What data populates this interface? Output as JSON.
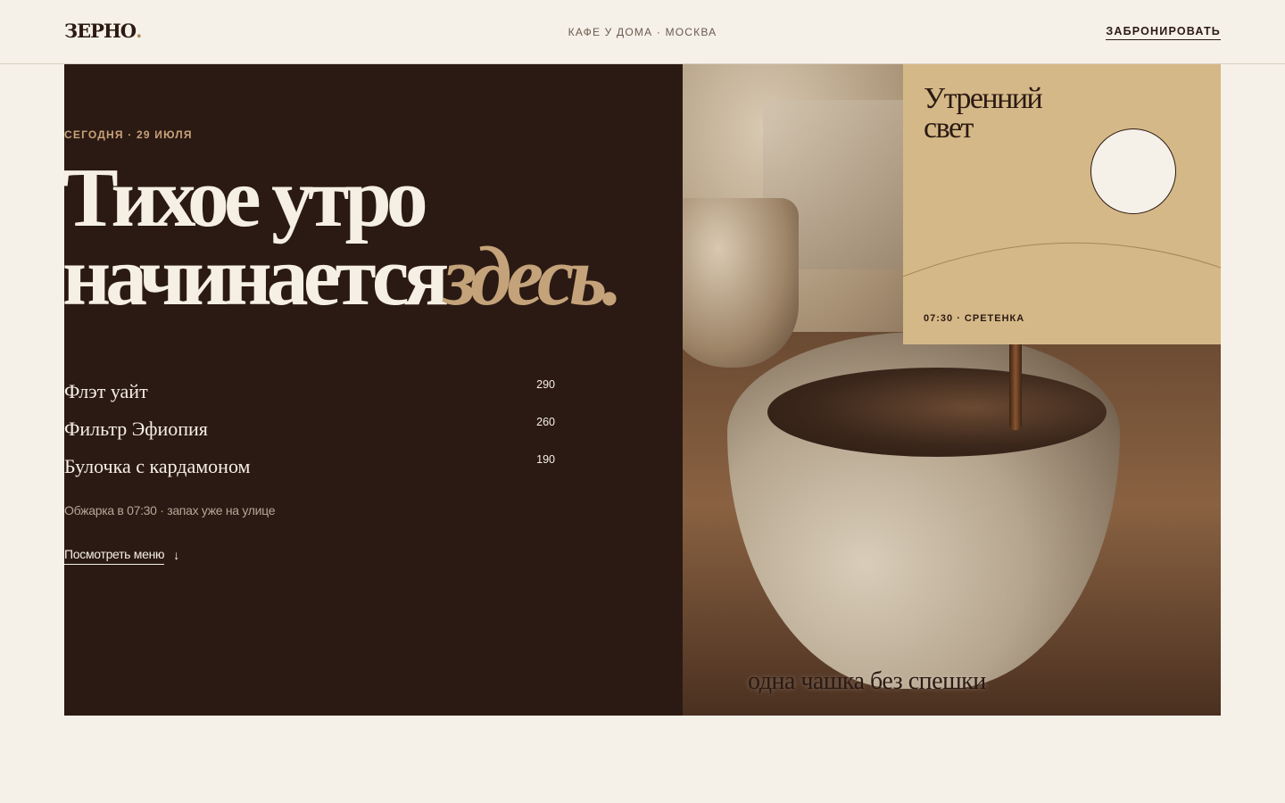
{
  "header": {
    "logo": "ЗЕРНО",
    "logo_dot": ".",
    "tagline": "КАФЕ У ДОМА · МОСКВА",
    "book_label": "ЗАБРОНИРОВАТЬ"
  },
  "hero": {
    "date": "СЕГОДНЯ · 29 ИЮЛЯ",
    "headline_line1": "Тихое утро",
    "headline_line2": "начинается",
    "headline_accent": "здесь.",
    "menu": [
      {
        "name": "Флэт уайт",
        "price": "290"
      },
      {
        "name": "Фильтр Эфиопия",
        "price": "260"
      },
      {
        "name": "Булочка с кардамоном",
        "price": "190"
      }
    ],
    "note": "Обжарка в 07:30 · запах уже на улице",
    "menu_link": "Посмотреть меню",
    "arrow_icon": "↓"
  },
  "photo": {
    "caption": "одна чашка без спешки"
  },
  "card": {
    "title_line1": "Утренний",
    "title_line2": "свет",
    "meta": "07:30 · СРЕТЕНКА"
  },
  "colors": {
    "dark": "#2b1a13",
    "cream": "#f5f0e8",
    "accent": "#c4a37a",
    "card": "#d5b887"
  }
}
